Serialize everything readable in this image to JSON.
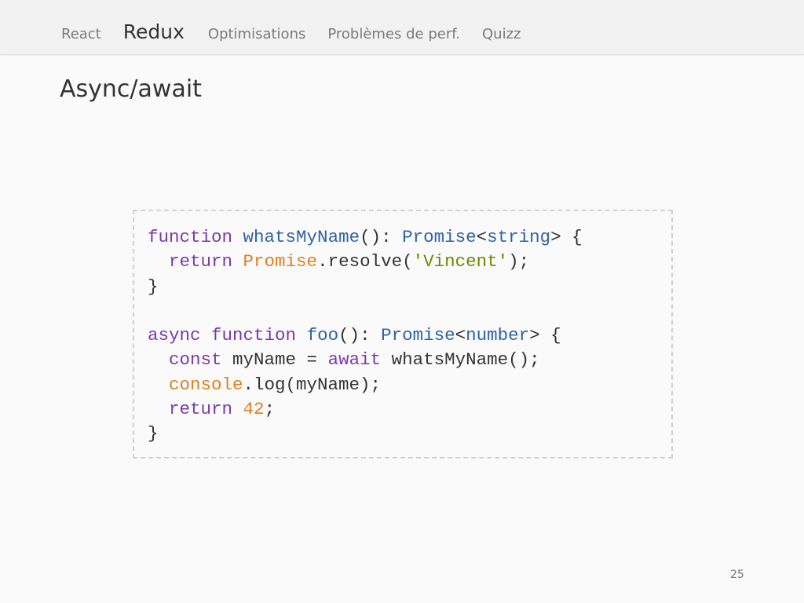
{
  "nav": {
    "items": [
      {
        "label": "React",
        "active": false
      },
      {
        "label": "Redux",
        "active": true
      },
      {
        "label": "Optimisations",
        "active": false
      },
      {
        "label": "Problèmes de perf.",
        "active": false
      },
      {
        "label": "Quizz",
        "active": false
      }
    ]
  },
  "slide": {
    "title": "Async/await",
    "page_number": "25"
  },
  "code": {
    "lines": [
      [
        [
          "kw",
          "function"
        ],
        [
          "pl",
          " "
        ],
        [
          "fn",
          "whatsMyName"
        ],
        [
          "pl",
          "(): "
        ],
        [
          "fn",
          "Promise"
        ],
        [
          "pl",
          "<"
        ],
        [
          "fn",
          "string"
        ],
        [
          "pl",
          "> {"
        ]
      ],
      [
        [
          "pl",
          "  "
        ],
        [
          "kw",
          "return"
        ],
        [
          "pl",
          " "
        ],
        [
          "bi",
          "Promise"
        ],
        [
          "pl",
          ".resolve("
        ],
        [
          "str",
          "'Vincent'"
        ],
        [
          "pl",
          ");"
        ]
      ],
      [
        [
          "pl",
          "}"
        ]
      ],
      [],
      [
        [
          "kw",
          "async"
        ],
        [
          "pl",
          " "
        ],
        [
          "kw",
          "function"
        ],
        [
          "pl",
          " "
        ],
        [
          "fn",
          "foo"
        ],
        [
          "pl",
          "(): "
        ],
        [
          "fn",
          "Promise"
        ],
        [
          "pl",
          "<"
        ],
        [
          "fn",
          "number"
        ],
        [
          "pl",
          "> {"
        ]
      ],
      [
        [
          "pl",
          "  "
        ],
        [
          "kw",
          "const"
        ],
        [
          "pl",
          " myName = "
        ],
        [
          "kw",
          "await"
        ],
        [
          "pl",
          " whatsMyName();"
        ]
      ],
      [
        [
          "pl",
          "  "
        ],
        [
          "bi",
          "console"
        ],
        [
          "pl",
          ".log(myName);"
        ]
      ],
      [
        [
          "pl",
          "  "
        ],
        [
          "kw",
          "return"
        ],
        [
          "pl",
          " "
        ],
        [
          "num",
          "42"
        ],
        [
          "pl",
          ";"
        ]
      ],
      [
        [
          "pl",
          "}"
        ]
      ]
    ]
  },
  "colors": {
    "keyword": "#7a3aa8",
    "identifier": "#2f62a5",
    "builtin": "#e07f1c",
    "string": "#6b8a00",
    "number": "#e07f1c"
  }
}
